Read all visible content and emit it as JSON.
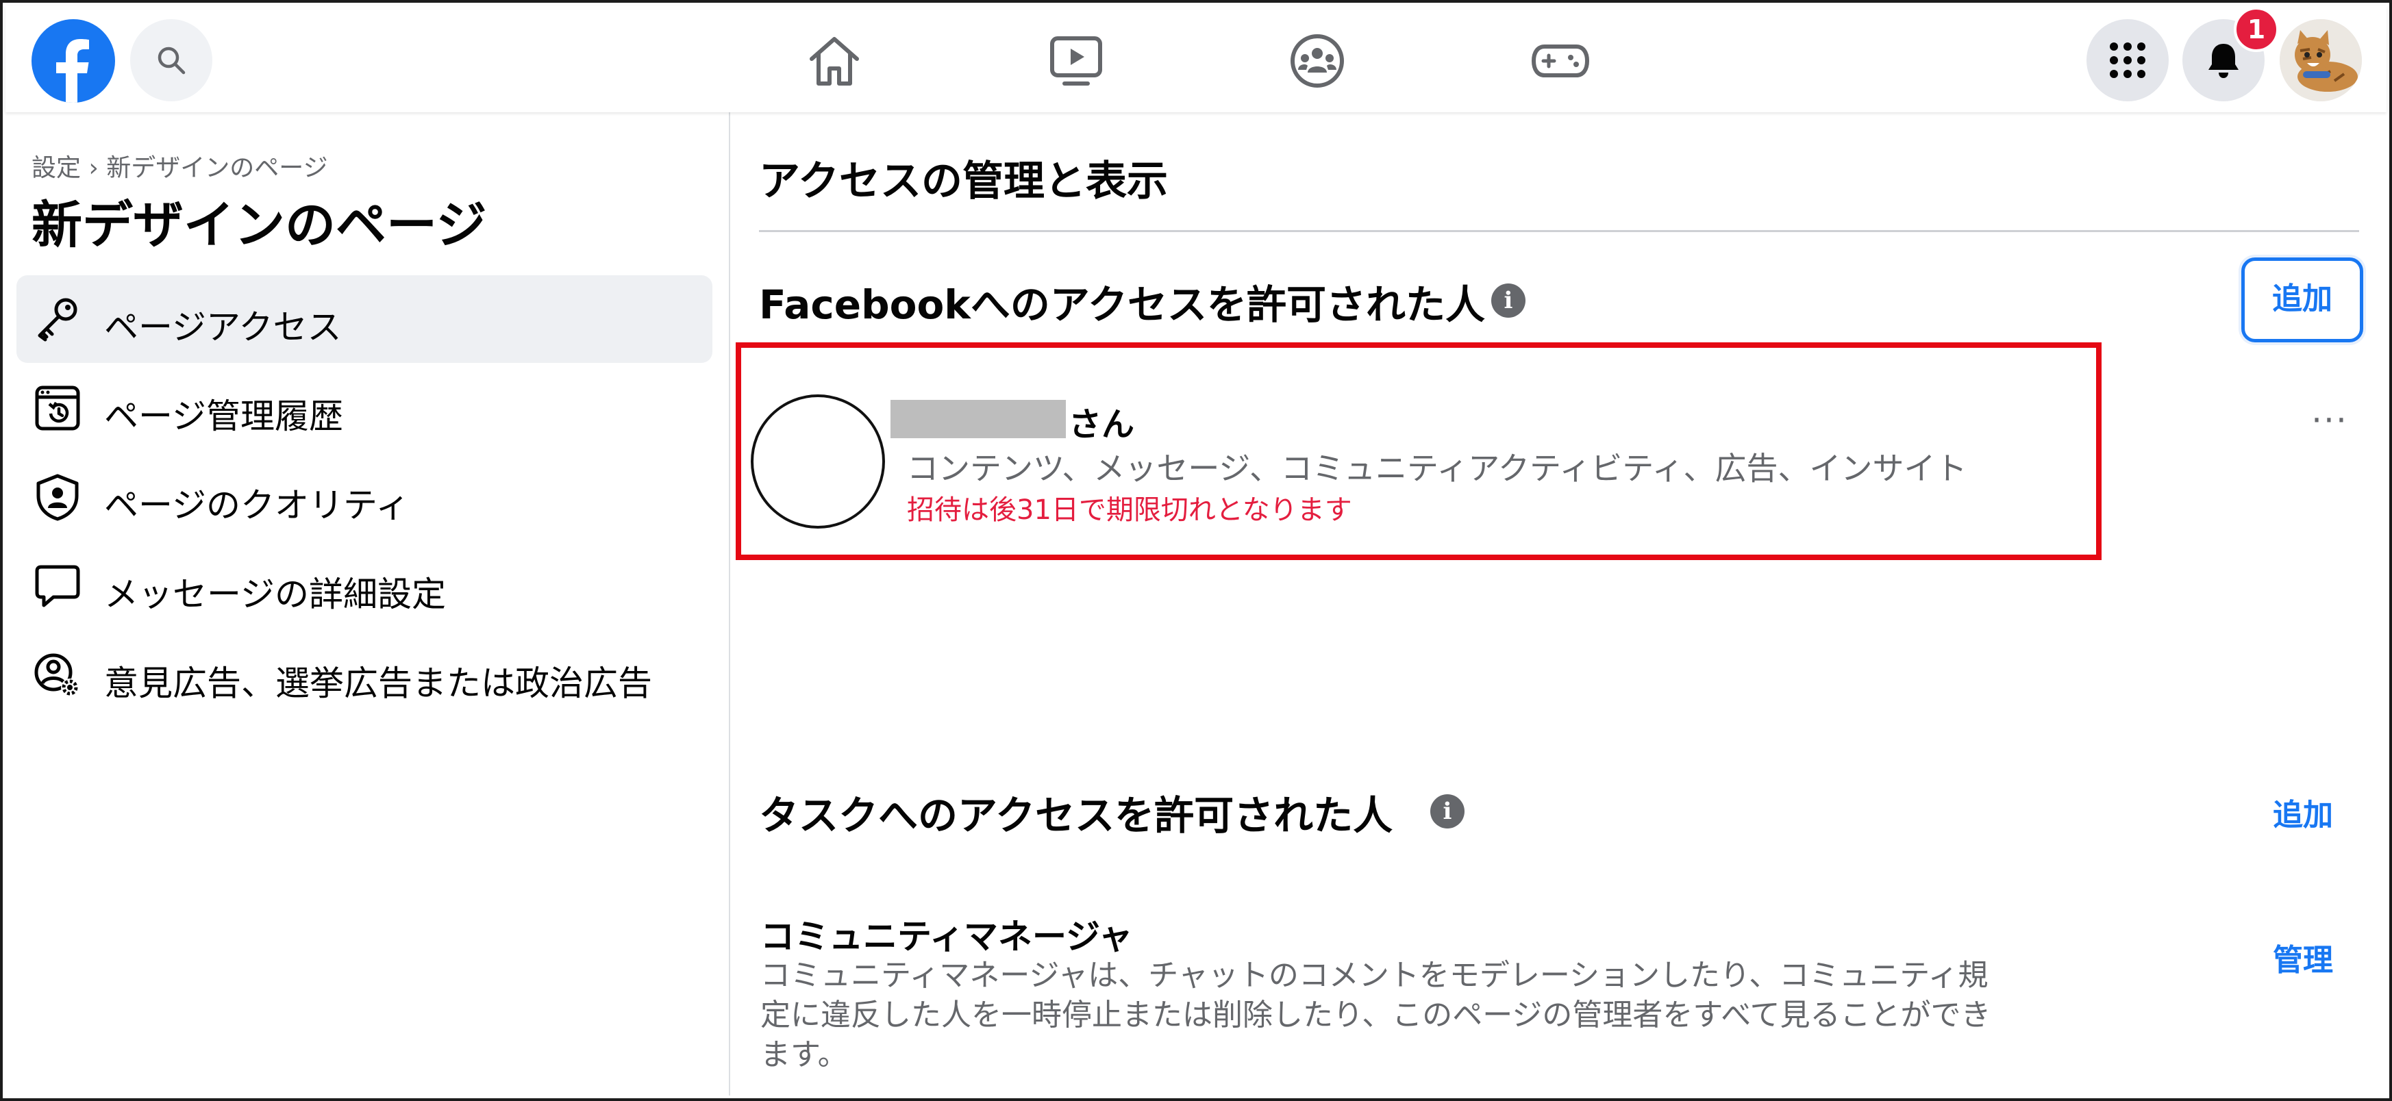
{
  "topbar": {
    "notifications_badge": "1",
    "icons": [
      "facebook-logo",
      "search-icon",
      "home-icon",
      "watch-icon",
      "groups-icon",
      "gaming-icon",
      "menu-grid-icon",
      "notifications-bell-icon",
      "profile-avatar"
    ]
  },
  "sidebar": {
    "breadcrumb": "設定 › 新デザインのページ",
    "title": "新デザインのページ",
    "items": [
      {
        "label": "ページアクセス",
        "icon": "key-icon",
        "active": true
      },
      {
        "label": "ページ管理履歴",
        "icon": "history-icon",
        "active": false
      },
      {
        "label": "ページのクオリティ",
        "icon": "shield-person-icon",
        "active": false
      },
      {
        "label": "メッセージの詳細設定",
        "icon": "chat-bubble-icon",
        "active": false
      },
      {
        "label": "意見広告、選挙広告または政治広告",
        "icon": "person-gear-icon",
        "active": false
      }
    ]
  },
  "main": {
    "section_title": "アクセスの管理と表示",
    "facebook_access": {
      "title": "Facebookへのアクセスを許可された人",
      "add_label": "追加",
      "person": {
        "name_suffix": "さん",
        "permissions": "コンテンツ、メッセージ、コミュニティアクティビティ、広告、インサイト",
        "warning": "招待は後31日で期限切れとなります",
        "more": "···"
      }
    },
    "task_access": {
      "title": "タスクへのアクセスを許可された人",
      "add_label": "追加"
    },
    "community_manager": {
      "title": "コミュニティマネージャ",
      "description": "コミュニティマネージャは、チャットのコメントをモデレーションしたり、コミュニティ規定に違反した人を一時停止または削除したり、このページの管理者をすべて見ることができます。",
      "manage_label": "管理"
    }
  },
  "colors": {
    "brand_blue": "#1877f2",
    "warning_red": "#e41e3f",
    "highlight_red": "#e50914",
    "secondary_text": "#65676b"
  }
}
